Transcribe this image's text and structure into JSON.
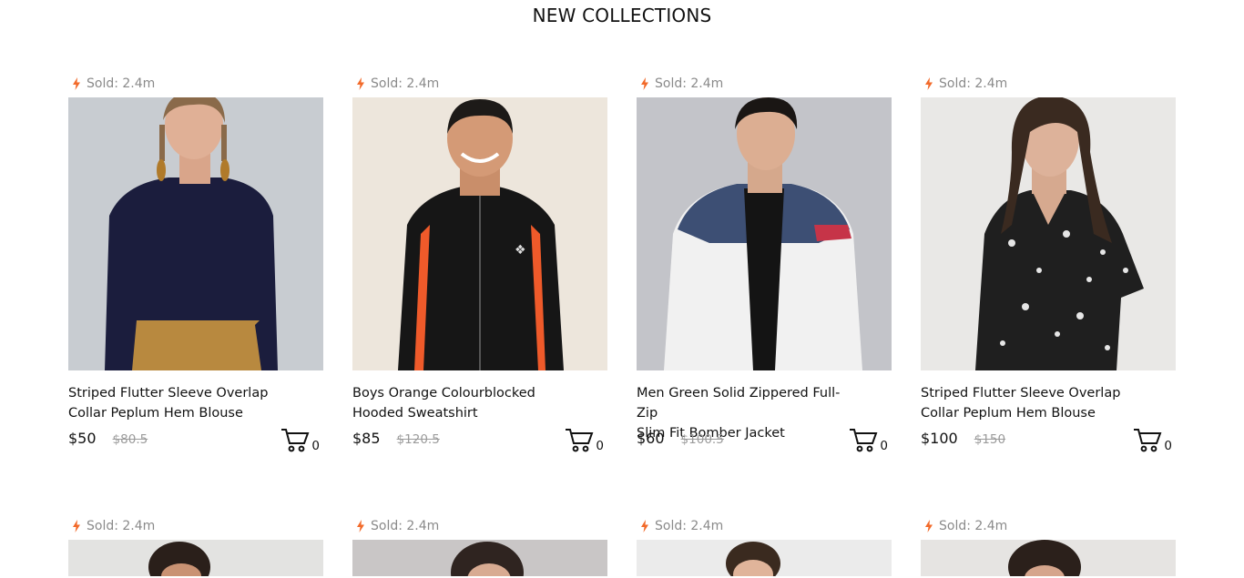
{
  "section": {
    "title": "NEW COLLECTIONS"
  },
  "colors": {
    "bolt": "#f26a2a",
    "text": "#111111",
    "muted": "#9b9b9b"
  },
  "products": [
    {
      "sold": "Sold: 2.4m",
      "title_l1": "Striped Flutter Sleeve Overlap",
      "title_l2": "Collar Peplum Hem Blouse",
      "price": "$50",
      "old_price": "$80.5",
      "cart_count": "0"
    },
    {
      "sold": "Sold: 2.4m",
      "title_l1": "Boys Orange Colourblocked",
      "title_l2": "Hooded Sweatshirt",
      "price": "$85",
      "old_price": "$120.5",
      "cart_count": "0"
    },
    {
      "sold": "Sold: 2.4m",
      "title_l1": "Men Green Solid Zippered Full-Zip",
      "title_l2": "Slim Fit Bomber Jacket",
      "price": "$60",
      "old_price": "$100.5",
      "cart_count": "0"
    },
    {
      "sold": "Sold: 2.4m",
      "title_l1": "Striped Flutter Sleeve Overlap",
      "title_l2": "Collar Peplum Hem Blouse",
      "price": "$100",
      "old_price": "$150",
      "cart_count": "0"
    }
  ],
  "products_row2": [
    {
      "sold": "Sold: 2.4m"
    },
    {
      "sold": "Sold: 2.4m"
    },
    {
      "sold": "Sold: 2.4m"
    },
    {
      "sold": "Sold: 2.4m"
    }
  ],
  "icons": {
    "sold": "bolt-icon",
    "cart": "cart-icon"
  }
}
